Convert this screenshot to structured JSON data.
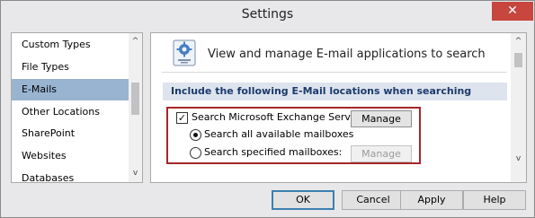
{
  "window": {
    "title": "Settings",
    "close_glyph": "✕"
  },
  "nav": {
    "items": [
      {
        "label": "Custom Types"
      },
      {
        "label": "File Types"
      },
      {
        "label": "E-Mails",
        "selected": true
      },
      {
        "label": "Other Locations"
      },
      {
        "label": "SharePoint"
      },
      {
        "label": "Websites"
      },
      {
        "label": "Databases"
      }
    ],
    "scroll_up_glyph": "^",
    "scroll_down_glyph": "v"
  },
  "panel": {
    "icon": "settings-gear-icon",
    "header": "View and manage E-mail applications to search",
    "section_title": "Include the following E-Mail locations when searching",
    "exchange": {
      "checkbox_label": "Search Microsoft Exchange Server:",
      "checked": true,
      "check_glyph": "✓",
      "manage_label": "Manage"
    },
    "all_mailboxes": {
      "label": "Search all available mailboxes",
      "checked": true
    },
    "specified_mailboxes": {
      "label": "Search specified mailboxes:",
      "checked": false,
      "manage_label": "Manage",
      "manage_disabled": true
    },
    "scroll_up_glyph": "^",
    "scroll_down_glyph": "v"
  },
  "buttons": {
    "ok": "OK",
    "cancel": "Cancel",
    "apply": "Apply",
    "help": "Help"
  },
  "colors": {
    "selected_nav": "#99b4d1",
    "section_bar": "#dde4ee",
    "highlight_border": "#a6262a",
    "close_button": "#c7463e"
  }
}
